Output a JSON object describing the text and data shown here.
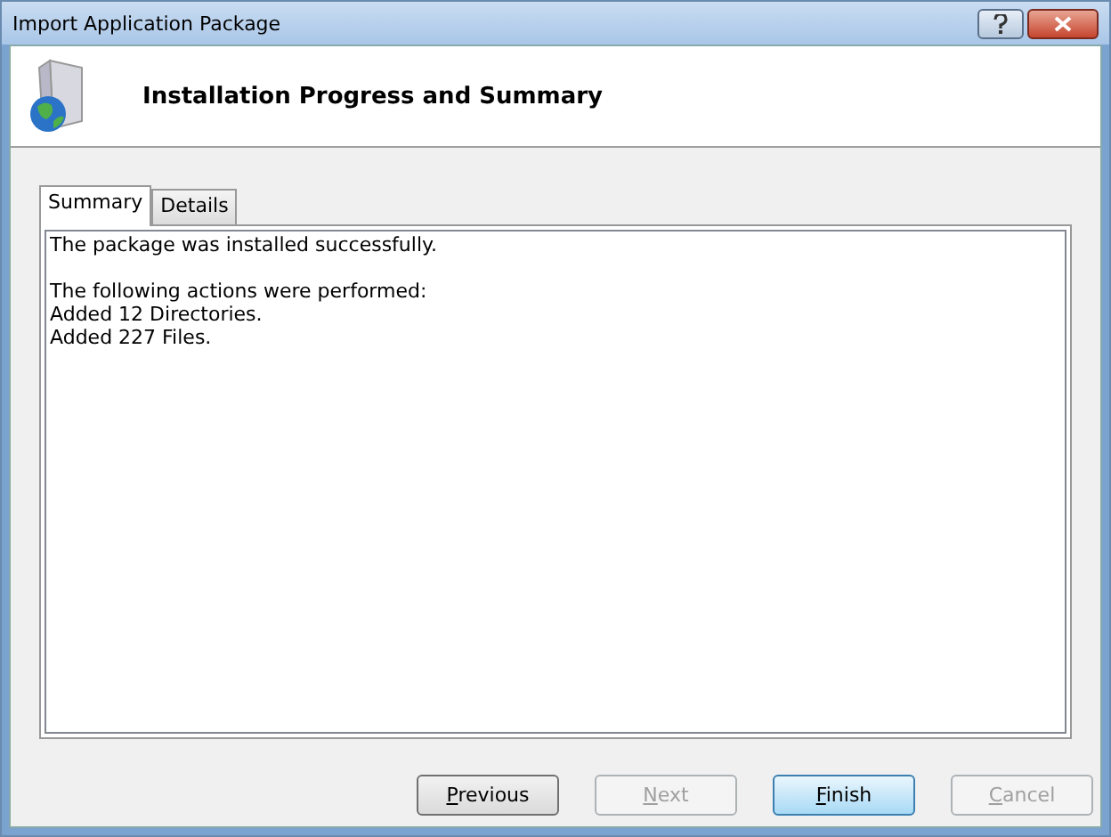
{
  "window": {
    "title": "Import Application Package"
  },
  "header": {
    "title": "Installation Progress and Summary"
  },
  "tabs": [
    {
      "label": "Summary",
      "selected": true
    },
    {
      "label": "Details",
      "selected": false
    }
  ],
  "summary": {
    "paragraphs": [
      [
        "The package was installed successfully."
      ],
      [
        "The following actions were performed:",
        "Added 12 Directories.",
        "Added 227 Files."
      ]
    ]
  },
  "buttons": [
    {
      "label": "Previous",
      "disabled": false,
      "default": false
    },
    {
      "label": "Next",
      "disabled": true,
      "default": false
    },
    {
      "label": "Finish",
      "disabled": false,
      "default": true
    },
    {
      "label": "Cancel",
      "disabled": true,
      "default": false
    }
  ]
}
